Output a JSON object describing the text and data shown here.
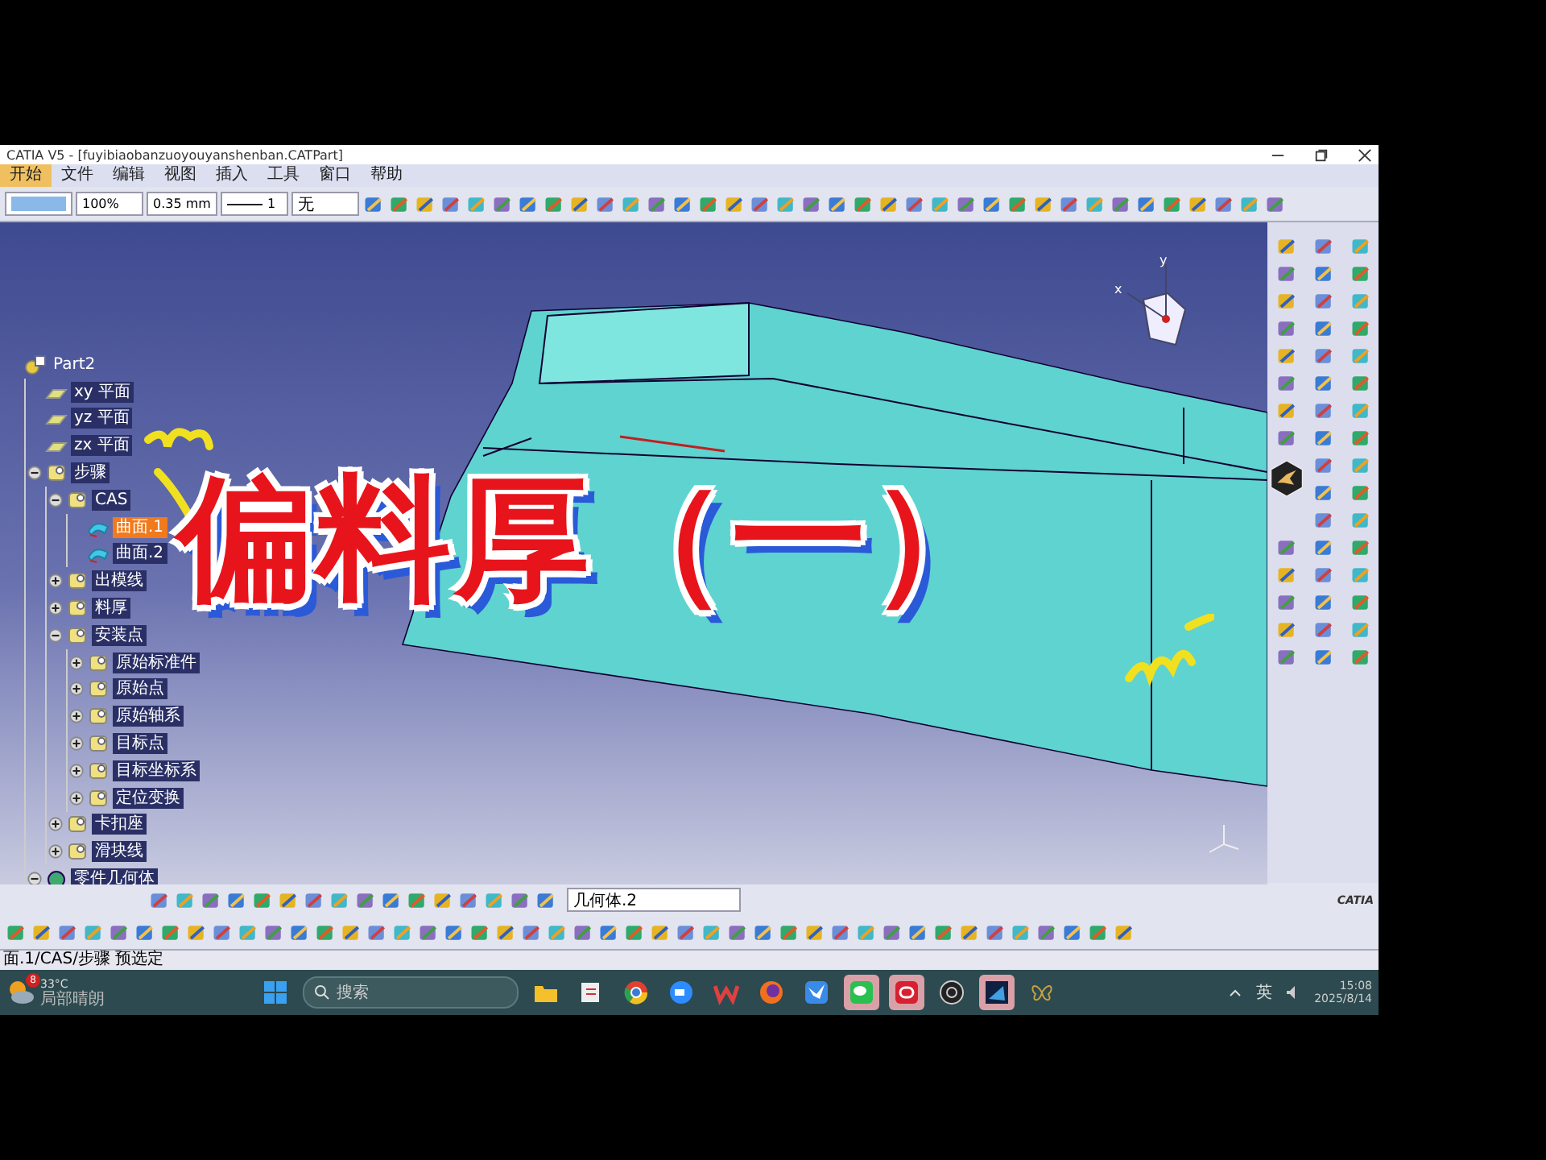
{
  "window": {
    "title": "CATIA V5 - [fuyibiaobanzuoyouyanshenban.CATPart]"
  },
  "menu": [
    {
      "label": "开始",
      "selected": true
    },
    {
      "label": "文件",
      "selected": false
    },
    {
      "label": "编辑",
      "selected": false
    },
    {
      "label": "视图",
      "selected": false
    },
    {
      "label": "插入",
      "selected": false
    },
    {
      "label": "工具",
      "selected": false
    },
    {
      "label": "窗口",
      "selected": false
    },
    {
      "label": "帮助",
      "selected": false
    }
  ],
  "toolbar": {
    "zoom": "100%",
    "thickness": "0.35 mm",
    "line_type": "1",
    "layer": "无"
  },
  "tree": [
    {
      "label": "Part2",
      "kind": "part",
      "selected": false,
      "children": [
        {
          "label": "xy 平面",
          "kind": "plane",
          "selected": false
        },
        {
          "label": "yz 平面",
          "kind": "plane",
          "selected": false
        },
        {
          "label": "zx 平面",
          "kind": "plane",
          "selected": false
        },
        {
          "label": "步骤",
          "kind": "set",
          "selected": false,
          "expanded": true,
          "children": [
            {
              "label": "CAS",
              "kind": "set",
              "selected": false,
              "expanded": true,
              "children": [
                {
                  "label": "曲面.1",
                  "kind": "surface",
                  "selected": true
                },
                {
                  "label": "曲面.2",
                  "kind": "surface",
                  "selected": false
                }
              ]
            },
            {
              "label": "出模线",
              "kind": "set",
              "selected": false,
              "expanded": false
            },
            {
              "label": "料厚",
              "kind": "set",
              "selected": false,
              "expanded": false
            },
            {
              "label": "安装点",
              "kind": "set",
              "selected": false,
              "expanded": true,
              "children": [
                {
                  "label": "原始标准件",
                  "kind": "set",
                  "selected": false,
                  "expanded": false
                },
                {
                  "label": "原始点",
                  "kind": "set",
                  "selected": false,
                  "expanded": false
                },
                {
                  "label": "原始轴系",
                  "kind": "set",
                  "selected": false,
                  "expanded": false
                },
                {
                  "label": "目标点",
                  "kind": "set",
                  "selected": false,
                  "expanded": false
                },
                {
                  "label": "目标坐标系",
                  "kind": "set",
                  "selected": false,
                  "expanded": false
                },
                {
                  "label": "定位变换",
                  "kind": "set",
                  "selected": false,
                  "expanded": false
                }
              ]
            },
            {
              "label": "卡扣座",
              "kind": "set",
              "selected": false,
              "expanded": false
            },
            {
              "label": "滑块线",
              "kind": "set",
              "selected": false,
              "expanded": false
            }
          ]
        },
        {
          "label": "零件几何体",
          "kind": "body",
          "selected": false,
          "expanded": true
        }
      ]
    }
  ],
  "title_overlay": "偏料厚（一）",
  "compass": {
    "x": "x",
    "y": "y"
  },
  "geometry_combo": "几何体.2",
  "logo": "CATIA",
  "status_bar": "面.1/CAS/步骤 预选定",
  "taskbar": {
    "weather": {
      "badge": "8",
      "temp": "33°C",
      "condition": "局部晴朗"
    },
    "search_placeholder": "搜索",
    "apps": [
      {
        "kind": "start",
        "active": false
      },
      {
        "kind": "files",
        "active": false
      },
      {
        "kind": "snip",
        "active": false
      },
      {
        "kind": "chrome",
        "active": false
      },
      {
        "kind": "zoom",
        "active": false
      },
      {
        "kind": "wps",
        "active": false
      },
      {
        "kind": "firefox",
        "active": false
      },
      {
        "kind": "bird",
        "active": false
      },
      {
        "kind": "chat",
        "active": true
      },
      {
        "kind": "red",
        "active": true
      },
      {
        "kind": "obs",
        "active": false
      },
      {
        "kind": "catia",
        "active": true
      },
      {
        "kind": "butterfly",
        "active": false
      }
    ],
    "language": "英",
    "time": "15:08",
    "date": "2025/8/14"
  }
}
